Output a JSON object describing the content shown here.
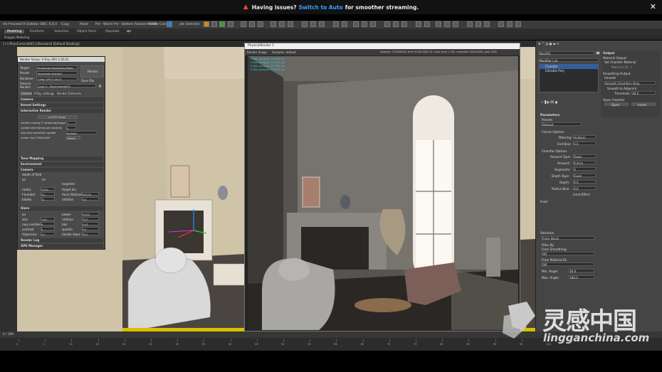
{
  "notice": {
    "text_before": "Having issues?",
    "link": "Switch to Auto",
    "text_after": "for smoother streaming.",
    "close": "✕"
  },
  "toolbar1": [
    {
      "label": "Viz Preview"
    },
    {
      "label": "FX Sidebar"
    },
    {
      "label": "OBC: 0,0,0"
    },
    {
      "label": "Copy"
    },
    {
      "label": "Paste"
    },
    {
      "label": "Pvl - World"
    },
    {
      "label": "Pvl - Bottom  Random UVW"
    },
    {
      "label": "Rotate Calc"
    },
    {
      "label": "ate Selected"
    }
  ],
  "ribbon_tabs": [
    "Modeling",
    "Freeform",
    "Selection",
    "Object Paint",
    "Populate"
  ],
  "subtab": "Polygon Modeling",
  "viewport_label": "[+] [PhysCamera001] [Standard] [Default Shading]",
  "render_setup": {
    "title": "Render Setup: V-Ray GPU 5.00.01",
    "target_label": "Target:",
    "target_value": "Production Rendering Mode",
    "preset_label": "Preset:",
    "preset_value": "No preset selected",
    "renderer_label": "Renderer:",
    "renderer_value": "V-Ray GPU 5.00.01",
    "save_file": "Save File",
    "view_label": "View to Render:",
    "view_value": "Quad 4 - PhysCamera001",
    "render_button": "Render",
    "tabs": [
      "Common",
      "V-Ray settings",
      "Render Elements"
    ],
    "sections": {
      "camera": "Camera",
      "kernel": "Kernel Settings",
      "interactive": "Interactive Render",
      "tone": "Tone Mapping",
      "environment": "Environment",
      "camera2": "Camera",
      "glare": "Glare",
      "log": "Render Log",
      "gpu": "GPU Manager"
    },
    "ir_button": "run IPT mode",
    "ir_rows": [
      {
        "label": "confirm closing IT rendering/image",
        "value": "1"
      },
      {
        "label": "update rate frames per seconds",
        "value": "5"
      },
      {
        "label": "max time geometry update",
        "value": "enabled"
      },
      {
        "label": "render size  1000x1000",
        "value": "refresh"
      }
    ],
    "dof_label": "depth of field",
    "cam_rows": [
      {
        "l": "on",
        "v": "on",
        "l2": "targeted",
        "v2": ""
      },
      {
        "l": "radius",
        "v": "0,000",
        "l2": "target dis.",
        "v2": ""
      },
      {
        "l": "f-number",
        "v": "8,0",
        "l2": "focal distance",
        "v2": "200,00"
      },
      {
        "l": "blades",
        "v": "12",
        "l2": "rotation",
        "v2": "0,0"
      }
    ],
    "glare_rows": [
      {
        "l": "on",
        "v": "",
        "l2": "power",
        "v2": "0,523"
      },
      {
        "l": "size",
        "v": "1,00",
        "l2": "rotation",
        "v2": "23,0"
      },
      {
        "l": "rays number",
        "v": "6",
        "l2": "blur",
        "v2": "0,43"
      },
      {
        "l": "contrast",
        "v": "0",
        "l2": "sparkle",
        "v2": "0,0"
      },
      {
        "l": "dispersion",
        "v": "0,0",
        "l2": "iterate steps",
        "v2": "50,0"
      }
    ]
  },
  "frame_buffer": {
    "title": "PhysicalRender 1",
    "toolbar_left": "Render Image",
    "toolbar_mid": "Samples: default",
    "stats_line": "samples: 272/500000, time 01:06:34/02:01, noise level 1.181, resolution 1000x1000, pass 1000",
    "overlay_lines": [
      "V-Ray samples: 0.0000 ms",
      "V-Ray samples: 0.0000 ms",
      "V-Ray samples: 0.0000 ms",
      "V-Ray samples: 0.0000 ms"
    ]
  },
  "right_panel": {
    "object_name": "Box001",
    "modifier_list": "Modifier List",
    "stack": [
      "Chamfer",
      "Editable Poly"
    ],
    "parameters": "Parameters",
    "presets": "Presets",
    "presets_value": "Default",
    "corner_options": "Corner Options",
    "mitering_label": "Mitering:",
    "mitering_value": "Uniform",
    "end_bias_label": "End Bias:",
    "end_bias_value": "0.5",
    "chamfer_options": "Chamfer Options",
    "amount_type_label": "Amount Type:",
    "amount_type_value": "Fixed",
    "amount_label": "Amount:",
    "amount_value": "0.4cm",
    "segments_label": "Segments:",
    "segments_value": "3",
    "depth_type_label": "Depth Type:",
    "depth_type_value": "Fixed",
    "depth_label": "Depth:",
    "depth_value": "0.5",
    "radius_bias_label": "Radius Bias:",
    "radius_bias_value": "0.0",
    "limit_effect": "Limit Effect",
    "feed": "Feed",
    "selection": "Selection",
    "selection_value": "From Stack",
    "filter_by": "Filter By",
    "from_smoothing": "From Smoothing:",
    "from_material": "From Material ID:",
    "off": "Off",
    "min_angle_label": "Min. Angle:",
    "min_angle_value": "30.0",
    "max_angle_label": "Max. Angle:",
    "max_angle_value": "180.0",
    "output": "Output",
    "material_output": "Material Output",
    "set_chamfer_material": "Set Chamfer Material",
    "material_id_label": "Material ID:",
    "material_id_value": "1",
    "smoothing_output": "Smoothing Output",
    "smooth": "Smooth",
    "smooth_value": "Smooth Chamfers Only",
    "smooth_to_adjacent": "Smooth to Adjacent",
    "threshold_label": "Threshold:",
    "threshold_value": "30.0",
    "open_chamfer": "Open Chamfer",
    "open_label": "Open",
    "invert_label": "Invert"
  },
  "timeline": {
    "frame": "0 / 100",
    "ticks": [
      "0",
      "5",
      "10",
      "15",
      "20",
      "25",
      "30",
      "35",
      "40",
      "45",
      "50",
      "55",
      "60",
      "65",
      "70",
      "75",
      "80",
      "85",
      "90",
      "95",
      "100"
    ]
  },
  "watermark": {
    "cn": "灵感中国",
    "url": "lingganchina.com"
  },
  "colors": {
    "accent": "#3aa0ff",
    "warn": "#e84a3a",
    "selection": "#2f5fa8",
    "stats": "#22d0e0"
  }
}
